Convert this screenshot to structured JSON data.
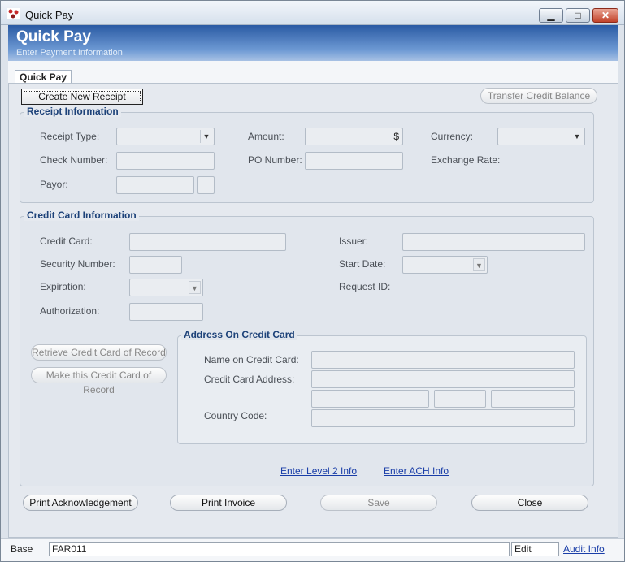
{
  "window": {
    "title": "Quick Pay"
  },
  "header": {
    "title": "Quick Pay",
    "subtitle": "Enter Payment Information"
  },
  "tabs": [
    {
      "label": "Quick Pay"
    }
  ],
  "actions": {
    "create_receipt": "Create New Receipt",
    "transfer_credit": "Transfer Credit Balance"
  },
  "receipt": {
    "title": "Receipt Information",
    "receipt_type": "Receipt Type:",
    "amount": "Amount:",
    "currency_symbol": "$",
    "currency": "Currency:",
    "check_number": "Check Number:",
    "po_number": "PO Number:",
    "exchange_rate": "Exchange Rate:",
    "payor": "Payor:"
  },
  "credit_card": {
    "title": "Credit Card Information",
    "credit_card": "Credit Card:",
    "issuer": "Issuer:",
    "security_number": "Security Number:",
    "start_date": "Start Date:",
    "expiration": "Expiration:",
    "request_id": "Request ID:",
    "authorization": "Authorization:",
    "retrieve_button": "Retrieve Credit Card of Record",
    "make_record_button": "Make this Credit Card of Record"
  },
  "address": {
    "title": "Address On Credit Card",
    "name": "Name on Credit Card:",
    "address": "Credit Card Address:",
    "country": "Country Code:"
  },
  "links": {
    "level2": "Enter Level 2 Info",
    "ach": "Enter ACH Info"
  },
  "footer": {
    "print_ack": "Print Acknowledgement",
    "print_invoice": "Print Invoice",
    "save": "Save",
    "close": "Close"
  },
  "status": {
    "mode": "Base",
    "code": "FAR011",
    "state": "Edit",
    "audit": "Audit Info"
  }
}
